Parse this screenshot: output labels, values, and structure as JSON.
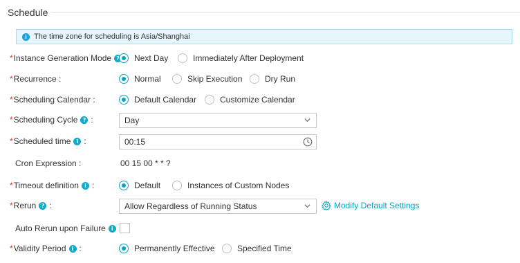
{
  "section": {
    "title": "Schedule"
  },
  "timezone_notice": "The time zone for scheduling is Asia/Shanghai",
  "colors": {
    "accent": "#0aa3c2",
    "required": "#e2341c",
    "alert_bg": "#e5f6fd"
  },
  "rows": {
    "instance_generation": {
      "label": "Instance Generation Mode",
      "options": [
        {
          "label": "Next Day",
          "checked": true
        },
        {
          "label": "Immediately After Deployment",
          "checked": false
        }
      ]
    },
    "recurrence": {
      "label": "Recurrence :",
      "options": [
        {
          "label": "Normal",
          "checked": true
        },
        {
          "label": "Skip Execution",
          "checked": false
        },
        {
          "label": "Dry Run",
          "checked": false
        }
      ]
    },
    "scheduling_calendar": {
      "label": "Scheduling Calendar :",
      "options": [
        {
          "label": "Default Calendar",
          "checked": true
        },
        {
          "label": "Customize Calendar",
          "checked": false
        }
      ]
    },
    "scheduling_cycle": {
      "label": "Scheduling Cycle",
      "colon": ":",
      "value": "Day"
    },
    "scheduled_time": {
      "label": "Scheduled time",
      "colon": ":",
      "value": "00:15"
    },
    "cron_expression": {
      "label": "Cron Expression :",
      "value": "00 15 00 * * ?"
    },
    "timeout_definition": {
      "label": "Timeout definition",
      "colon": ":",
      "options": [
        {
          "label": "Default",
          "checked": true
        },
        {
          "label": "Instances of Custom Nodes",
          "checked": false
        }
      ]
    },
    "rerun": {
      "label": "Rerun",
      "colon": ":",
      "value": "Allow Regardless of Running Status",
      "link": "Modify Default Settings"
    },
    "auto_rerun": {
      "label": "Auto Rerun upon Failure",
      "colon": ":",
      "checked": false
    },
    "validity_period": {
      "label": "Validity Period",
      "colon": ":",
      "options": [
        {
          "label": "Permanently Effective",
          "checked": true
        },
        {
          "label": "Specified Time",
          "checked": false
        }
      ]
    }
  }
}
